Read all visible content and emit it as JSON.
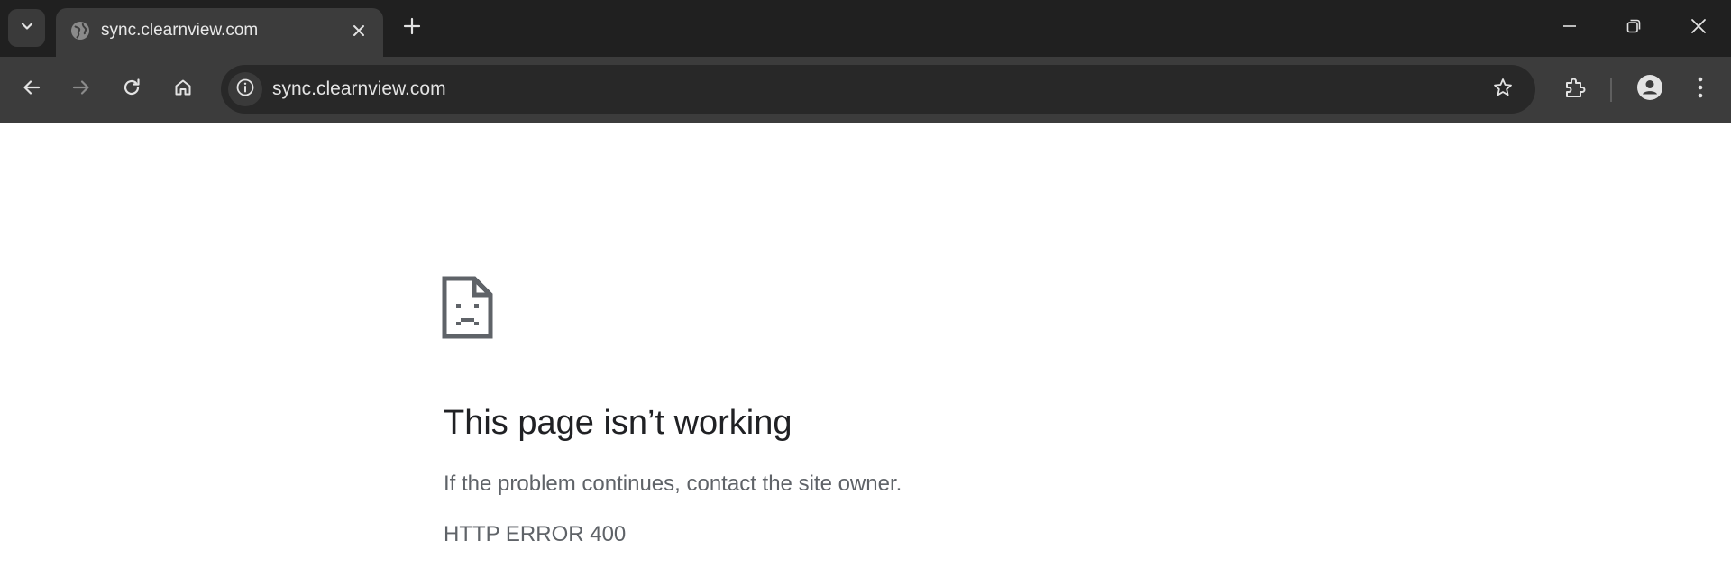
{
  "tab": {
    "title": "sync.clearnview.com",
    "favicon": "globe-icon"
  },
  "window_controls": [
    "minimize-icon",
    "restore-icon",
    "close-icon"
  ],
  "toolbar": {
    "buttons": [
      "back-arrow-icon",
      "forward-arrow-icon",
      "reload-icon",
      "home-icon"
    ],
    "forward_enabled": false
  },
  "omnibox": {
    "url": "sync.clearnview.com",
    "site_info_icon": "info-icon",
    "bookmark_icon": "star-icon"
  },
  "toolbar_right": [
    "extensions-icon",
    "profile-icon",
    "more-vert-icon"
  ],
  "error_page": {
    "icon": "sad-document-icon",
    "heading": "This page isn’t working",
    "message": "If the problem continues, contact the site owner.",
    "code": "HTTP ERROR 400"
  },
  "colors": {
    "tabstrip_bg": "#202020",
    "toolbar_bg": "#3c3c3c",
    "omnibox_bg": "#282828",
    "heading": "#202124",
    "body_text": "#5f6368"
  }
}
